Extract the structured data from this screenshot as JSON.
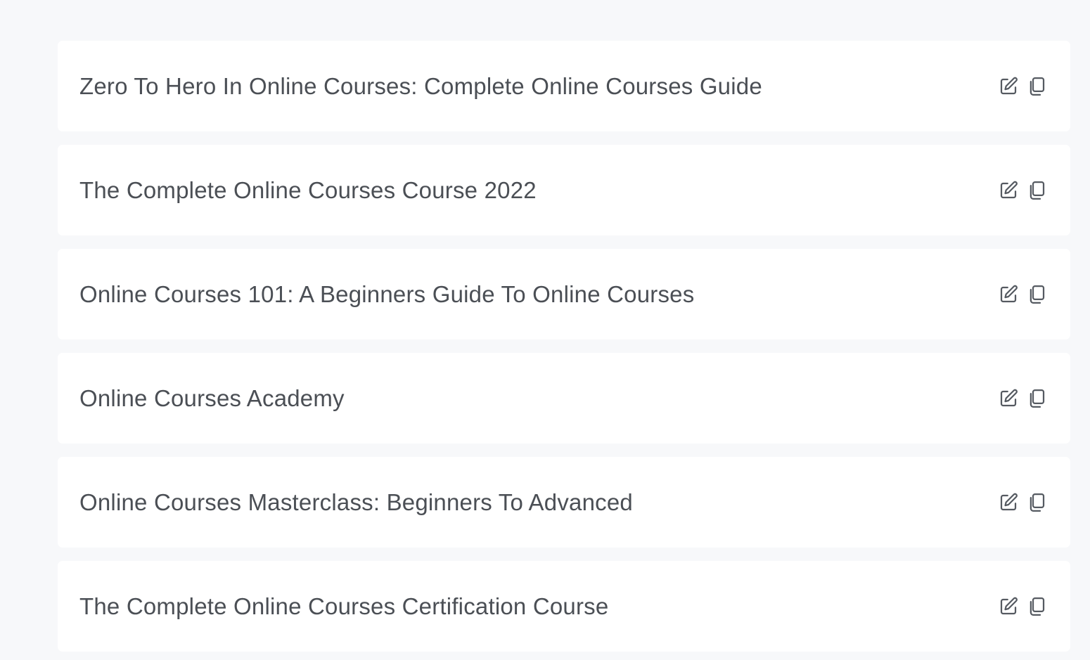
{
  "titles": {
    "items": [
      {
        "title": "Zero To Hero In Online Courses: Complete Online Courses Guide"
      },
      {
        "title": "The Complete Online Courses Course 2022"
      },
      {
        "title": "Online Courses 101: A Beginners Guide To Online Courses"
      },
      {
        "title": "Online Courses Academy"
      },
      {
        "title": "Online Courses Masterclass: Beginners To Advanced"
      },
      {
        "title": "The Complete Online Courses Certification Course"
      }
    ],
    "item_icons": [
      "edit-icon",
      "copy-icon"
    ]
  },
  "colors": {
    "background": "#f7f8fa",
    "card": "#ffffff",
    "text": "#4b4f55",
    "icon": "#555a61"
  }
}
